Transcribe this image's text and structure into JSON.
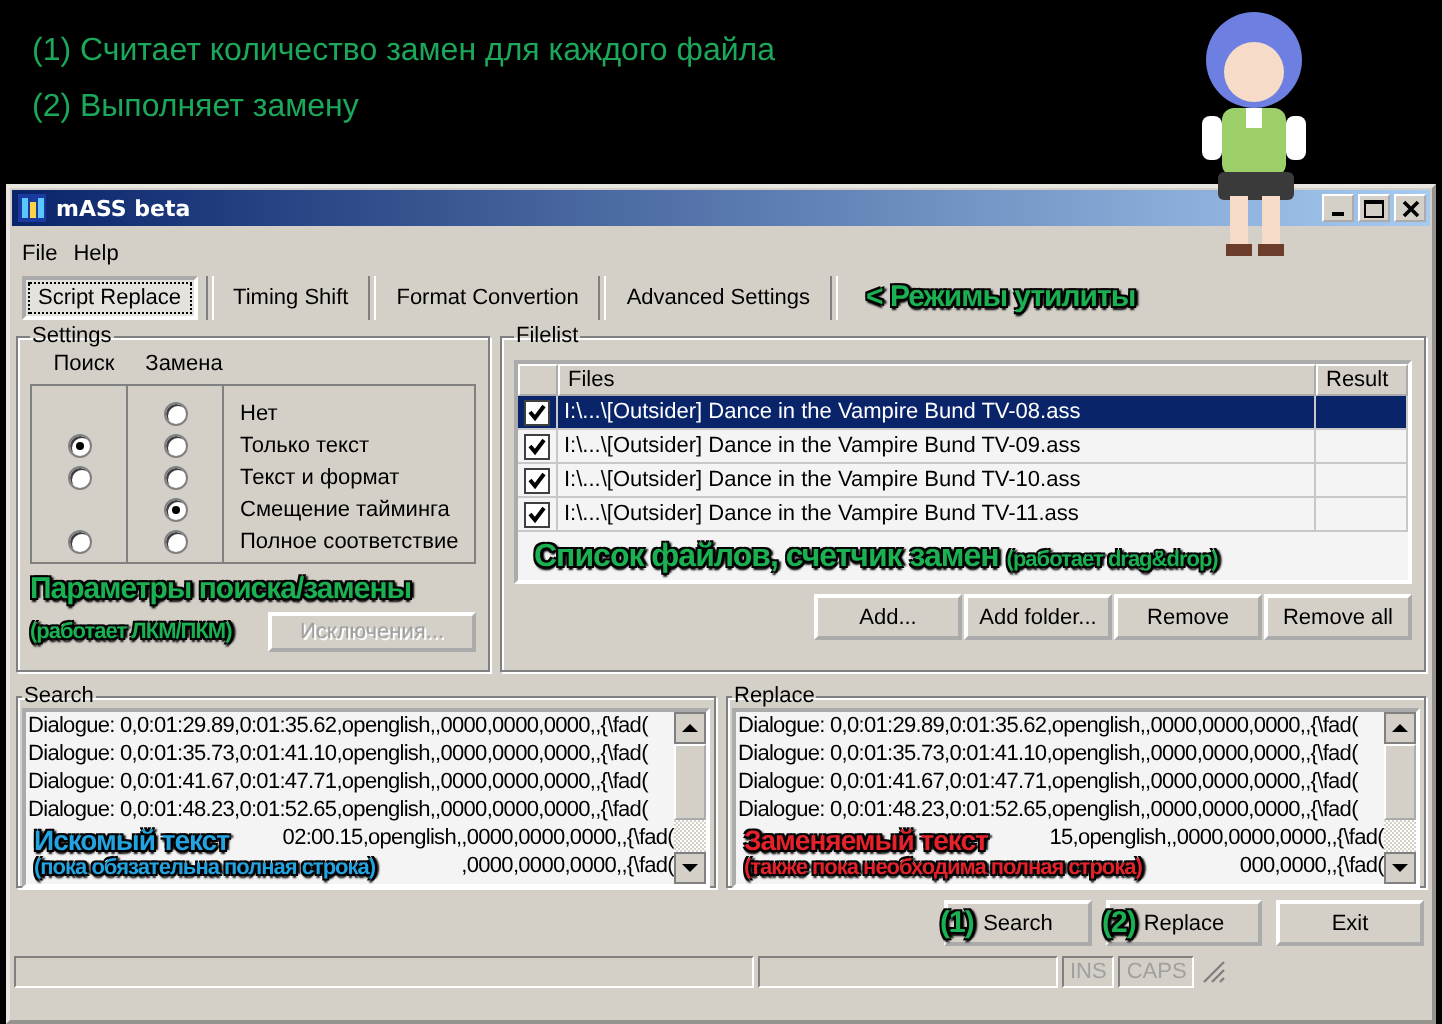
{
  "intro": [
    "(1) Считает количество замен для каждого файла",
    "(2) Выполняет замену"
  ],
  "window": {
    "title": "mASS beta"
  },
  "menu": [
    "File",
    "Help"
  ],
  "tabs": [
    {
      "label": "Script Replace",
      "selected": true
    },
    {
      "label": "Timing Shift",
      "selected": false
    },
    {
      "label": "Format Convertion",
      "selected": false
    },
    {
      "label": "Advanced Settings",
      "selected": false
    }
  ],
  "tabs_annotation": "< Режимы утилиты",
  "settings": {
    "title": "Settings",
    "headers": [
      "Поиск",
      "Замена"
    ],
    "rows": [
      {
        "label": "Нет",
        "replace": {
          "selected": false
        }
      },
      {
        "label": "Только текст",
        "search": {
          "selected": true
        },
        "replace": {
          "selected": false
        }
      },
      {
        "label": "Текст и формат",
        "search": {
          "selected": false
        },
        "replace": {
          "selected": false
        }
      },
      {
        "label": "Смещение тайминга",
        "replace": {
          "selected": true
        }
      },
      {
        "label": "Полное соответствие",
        "search": {
          "selected": false
        },
        "replace": {
          "selected": false
        }
      }
    ],
    "buttons": [
      {
        "label": "Исключения...",
        "disabled": true
      }
    ],
    "annotation": {
      "title": "Параметры поиска/замены",
      "note": "(работает ЛКМ/ПКМ)"
    }
  },
  "filelist": {
    "title": "Filelist",
    "columns": [
      "Files",
      "Result"
    ],
    "rows": [
      {
        "checked": true,
        "selected": true,
        "file": "I:\\...\\[Outsider] Dance in the Vampire Bund TV-08.ass"
      },
      {
        "checked": true,
        "selected": false,
        "file": "I:\\...\\[Outsider] Dance in the Vampire Bund TV-09.ass"
      },
      {
        "checked": true,
        "selected": false,
        "file": "I:\\...\\[Outsider] Dance in the Vampire Bund TV-10.ass"
      },
      {
        "checked": true,
        "selected": false,
        "file": "I:\\...\\[Outsider] Dance in the Vampire Bund TV-11.ass"
      }
    ],
    "annotation": {
      "title": "Список файлов, счетчик замен",
      "note": "(работает drag&drop)"
    },
    "buttons": [
      "Add...",
      "Add folder...",
      "Remove",
      "Remove all"
    ]
  },
  "search": {
    "title": "Search",
    "lines": [
      {
        "kind": "full",
        "text": "Dialogue: 0,0:01:29.89,0:01:35.62,openglish,,0000,0000,0000,,{\\fad("
      },
      {
        "kind": "full",
        "text": "Dialogue: 0,0:01:35.73,0:01:41.10,openglish,,0000,0000,0000,,{\\fad("
      },
      {
        "kind": "full",
        "text": "Dialogue: 0,0:01:41.67,0:01:47.71,openglish,,0000,0000,0000,,{\\fad("
      },
      {
        "kind": "full",
        "text": "Dialogue: 0,0:01:48.23,0:01:52.65,openglish,,0000,0000,0000,,{\\fad("
      },
      {
        "kind": "partial",
        "text": "02:00.15,openglish,,0000,0000,0000,,{\\fad("
      },
      {
        "kind": "partial",
        "text": ",0000,0000,0000,,{\\fad("
      }
    ],
    "annotation": {
      "title": "Искомый текст",
      "note": "(пока обязательна полная строка)"
    }
  },
  "replace": {
    "title": "Replace",
    "lines": [
      {
        "kind": "full",
        "text": "Dialogue: 0,0:01:29.89,0:01:35.62,openglish,,0000,0000,0000,,{\\fad("
      },
      {
        "kind": "full",
        "text": "Dialogue: 0,0:01:35.73,0:01:41.10,openglish,,0000,0000,0000,,{\\fad("
      },
      {
        "kind": "full",
        "text": "Dialogue: 0,0:01:41.67,0:01:47.71,openglish,,0000,0000,0000,,{\\fad("
      },
      {
        "kind": "full",
        "text": "Dialogue: 0,0:01:48.23,0:01:52.65,openglish,,0000,0000,0000,,{\\fad("
      },
      {
        "kind": "partial",
        "text": "15,openglish,,0000,0000,0000,,{\\fad("
      },
      {
        "kind": "partial",
        "text": "000,0000,,{\\fad("
      }
    ],
    "annotation": {
      "title": "Заменяемый текст",
      "note": "(также пока необходима полная строка)"
    }
  },
  "actions": [
    {
      "label": "Search",
      "marker": "(1)"
    },
    {
      "label": "Replace",
      "marker": "(2)"
    },
    {
      "label": "Exit"
    }
  ],
  "status_bar": [
    {
      "label": "INS",
      "disabled": true
    },
    {
      "label": "CAPS",
      "disabled": true
    }
  ]
}
